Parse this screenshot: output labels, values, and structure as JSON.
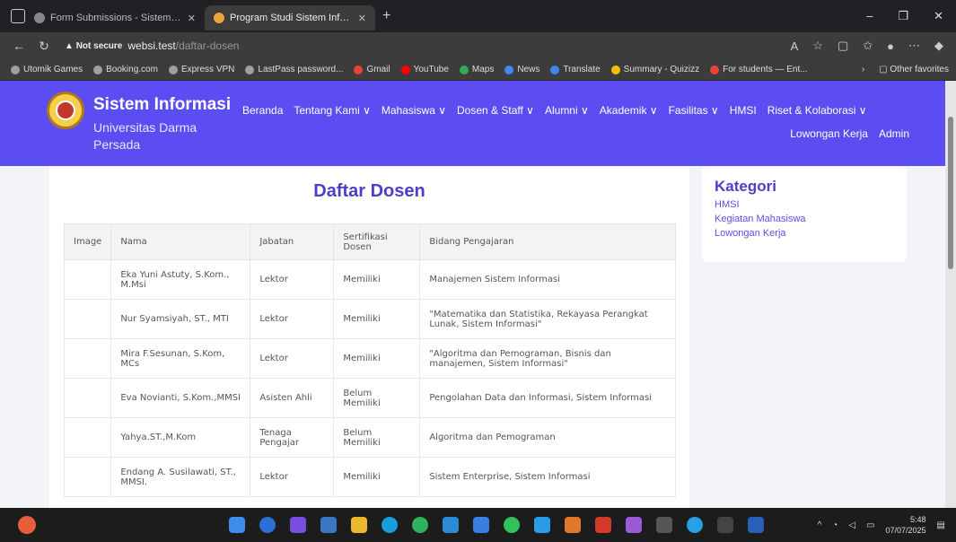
{
  "browser": {
    "tabs": [
      {
        "title": "Form Submissions - Sistem Infor",
        "active": false
      },
      {
        "title": "Program Studi Sistem Informasi",
        "active": true
      }
    ],
    "address": {
      "security": "Not secure",
      "host": "websi.test",
      "path": "/daftar-dosen"
    },
    "bookmarks": [
      "Utomik Games",
      "Booking.com",
      "Express VPN",
      "LastPass password...",
      "Gmail",
      "YouTube",
      "Maps",
      "News",
      "Translate",
      "Summary - Quizizz",
      "For students — Ent..."
    ],
    "other_favorites": "Other favorites"
  },
  "site": {
    "brand_title": "Sistem Informasi",
    "brand_sub": "Universitas Darma Persada",
    "menu": [
      "Beranda",
      "Tentang Kami ∨",
      "Mahasiswa ∨",
      "Dosen & Staff ∨",
      "Alumni ∨",
      "Akademik ∨",
      "Fasilitas ∨",
      "HMSI",
      "Riset & Kolaborasi ∨"
    ],
    "menu2": [
      "Lowongan Kerja",
      "Admin"
    ]
  },
  "main": {
    "title": "Daftar Dosen",
    "columns": [
      "Image",
      "Nama",
      "Jabatan",
      "Sertifikasi Dosen",
      "Bidang Pengajaran"
    ],
    "rows": [
      {
        "nama": "Eka Yuni Astuty, S.Kom., M.Msi",
        "jabatan": "Lektor",
        "sertifikasi": "Memiliki",
        "bidang": "Manajemen Sistem Informasi"
      },
      {
        "nama": "Nur Syamsiyah, ST., MTI",
        "jabatan": "Lektor",
        "sertifikasi": "Memiliki",
        "bidang": "\"Matematika dan Statistika, Rekayasa Perangkat Lunak, Sistem Informasi\""
      },
      {
        "nama": "Mira F.Sesunan, S.Kom, MCs",
        "jabatan": "Lektor",
        "sertifikasi": "Memiliki",
        "bidang": "\"Algoritma dan Pemograman, Bisnis dan manajemen, Sistem Informasi\""
      },
      {
        "nama": "Eva Novianti, S.Kom.,MMSI",
        "jabatan": "Asisten Ahli",
        "sertifikasi": "Belum Memiliki",
        "bidang": "Pengolahan Data dan Informasi, Sistem Informasi"
      },
      {
        "nama": "Yahya.ST.,M.Kom",
        "jabatan": "Tenaga Pengajar",
        "sertifikasi": "Belum Memiliki",
        "bidang": "Algoritma dan Pemograman"
      },
      {
        "nama": "Endang A. Susilawati, ST., MMSI.",
        "jabatan": "Lektor",
        "sertifikasi": "Memiliki",
        "bidang": "Sistem Enterprise, Sistem Informasi"
      }
    ]
  },
  "sidebar": {
    "title": "Kategori",
    "items": [
      "HMSI",
      "Kegiatan Mahasiswa",
      "Lowongan Kerja"
    ]
  },
  "taskbar": {
    "time": "5:48",
    "date": "07/07/2025"
  },
  "colors": {
    "header_bg": "#5b4df2",
    "title_color": "#4b3fc7"
  }
}
